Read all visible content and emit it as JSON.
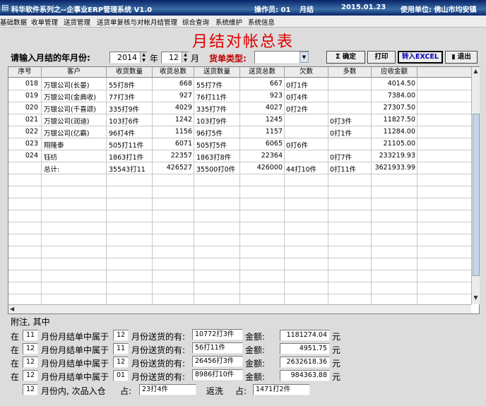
{
  "titlebar": {
    "title": "科华软件系列之--企事业ERP管理系统 V1.0",
    "operator": "操作员: 01",
    "module": "月结",
    "date": "2015.01.23",
    "unit": "使用单位: 佛山市均安镇"
  },
  "menu": [
    "基础数据",
    "收单管理",
    "送货管理",
    "送货单复核与对帐月结管理",
    "综合查询",
    "系统维护",
    "系统信息"
  ],
  "heading": "月结对帐总表",
  "query": {
    "prompt": "请输入月结的年月份:",
    "year": "2014",
    "year_unit": "年",
    "month": "12",
    "month_unit": "月",
    "type_label": "货单类型:",
    "type_value": ""
  },
  "buttons": {
    "confirm": "确定",
    "print": "打印",
    "excel": "转入EXCEL",
    "exit": "退出"
  },
  "table": {
    "headers": [
      "序号",
      "客户",
      "收货数量",
      "收货总数",
      "送货数量",
      "送货总数",
      "欠数",
      "多数",
      "应收金额"
    ],
    "rows": [
      [
        "018",
        "万银公司(长晏)",
        "55打8件",
        "668",
        "55打7件",
        "667",
        "0打1件",
        "",
        "4014.50"
      ],
      [
        "019",
        "万银公司(金典收)",
        "77打3件",
        "927",
        "76打11件",
        "923",
        "0打4件",
        "",
        "7384.00"
      ],
      [
        "020",
        "万银公司(千喜颂)",
        "335打9件",
        "4029",
        "335打7件",
        "4027",
        "0打2件",
        "",
        "27307.50"
      ],
      [
        "021",
        "万银公司(润迪)",
        "103打6件",
        "1242",
        "103打9件",
        "1245",
        "",
        "0打3件",
        "11827.50"
      ],
      [
        "022",
        "万银公司(亿霸)",
        "96打4件",
        "1156",
        "96打5件",
        "1157",
        "",
        "0打1件",
        "11284.00"
      ],
      [
        "023",
        "翔隆泰",
        "505打11件",
        "6071",
        "505打5件",
        "6065",
        "0打6件",
        "",
        "21105.00"
      ],
      [
        "024",
        "钰纺",
        "1863打1件",
        "22357",
        "1863打8件",
        "22364",
        "",
        "0打7件",
        "233219.93"
      ],
      [
        "",
        "总计:",
        "35543打11",
        "426527",
        "35500打0件",
        "426000",
        "44打10件",
        "0打11件",
        "3621933.99"
      ]
    ]
  },
  "notes": {
    "title": "附注, 其中",
    "lines": [
      {
        "pre": "在",
        "m1": "11",
        "mid": "月份月结单中属于",
        "m2": "12",
        "post": "月份送货的有:",
        "qty": "10772打3件",
        "amt_label": "金额:",
        "amount": "1181274.04",
        "unit": "元"
      },
      {
        "pre": "在",
        "m1": "12",
        "mid": "月份月结单中属于",
        "m2": "11",
        "post": "月份送货的有:",
        "qty": "56打11件",
        "amt_label": "金额:",
        "amount": "4951.75",
        "unit": "元"
      },
      {
        "pre": "在",
        "m1": "12",
        "mid": "月份月结单中属于",
        "m2": "12",
        "post": "月份送货的有:",
        "qty": "26456打3件",
        "amt_label": "金额:",
        "amount": "2632618.36",
        "unit": "元"
      },
      {
        "pre": "在",
        "m1": "12",
        "mid": "月份月结单中属于",
        "m2": "01",
        "post": "月份送货的有:",
        "qty": "8986打10件",
        "amt_label": "金额:",
        "amount": "984363.88",
        "unit": "元"
      }
    ],
    "last": {
      "month": "12",
      "text1": "月份内, 次品入仓",
      "occupy1": "占:",
      "defect": "23打4件",
      "text2": "返洗",
      "occupy2": "占:",
      "rewash": "1471打2件"
    }
  }
}
